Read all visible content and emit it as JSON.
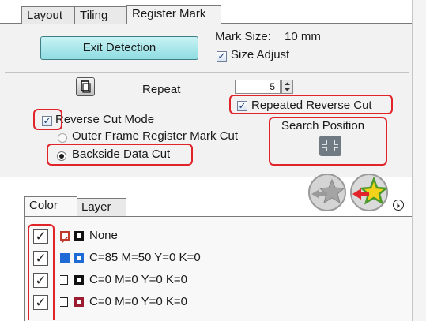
{
  "top_tabs": [
    "Layout",
    "Tiling",
    "Register Mark"
  ],
  "register_mark": {
    "exit_button": "Exit Detection",
    "mark_size_label": "Mark Size:",
    "mark_size_value": "10 mm",
    "size_adjust_label": "Size Adjust",
    "size_adjust_checked": true,
    "repeat_label": "Repeat",
    "repeat_value": "5",
    "repeated_reverse_cut_label": "Repeated Reverse Cut",
    "repeated_reverse_cut_checked": true,
    "reverse_cut_mode_label": "Reverse Cut Mode",
    "reverse_cut_mode_checked": true,
    "outer_frame_label": "Outer Frame Register Mark Cut",
    "backside_label": "Backside Data Cut",
    "selected_radio": "Backside Data Cut",
    "search_position_label": "Search Position"
  },
  "bottom_tabs": [
    "Color",
    "Layer"
  ],
  "color_list": [
    {
      "label": "None",
      "checked": true,
      "swatch_fill": "#ffffff",
      "swatch_stroke": "#c0392b",
      "box_color": "#111111"
    },
    {
      "label": "C=85 M=50 Y=0 K=0",
      "checked": true,
      "swatch_fill": "#1e6bd6",
      "swatch_stroke": "#1e6bd6",
      "box_color": "#1e6bd6"
    },
    {
      "label": "C=0 M=0 Y=0 K=0",
      "checked": true,
      "swatch_fill": "#ffffff",
      "swatch_stroke": "#222222",
      "box_color": "#111111"
    },
    {
      "label": "C=0 M=0 Y=0 K=0",
      "checked": true,
      "swatch_fill": "#ffffff",
      "swatch_stroke": "#222222",
      "box_color": "#9b1b30"
    }
  ],
  "colors": {
    "highlight": "#e0242a",
    "button": "#8fdde2",
    "panel": "#f2f2f2"
  },
  "icons": [
    "repeat-icon",
    "search-position-icon",
    "star-disabled-icon",
    "star-add-icon",
    "panel-menu-icon"
  ]
}
